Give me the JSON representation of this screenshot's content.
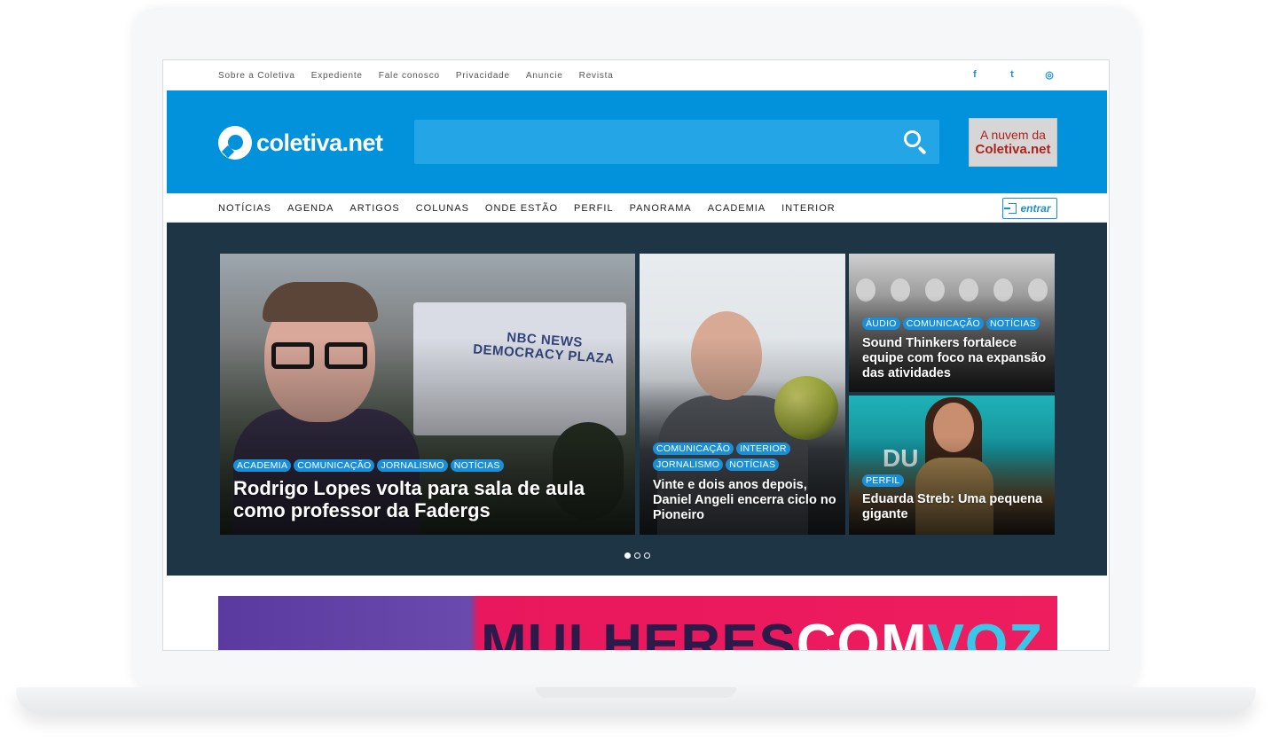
{
  "top_links": [
    "Sobre a Coletiva",
    "Expediente",
    "Fale conosco",
    "Privacidade",
    "Anuncie",
    "Revista"
  ],
  "social_icons": [
    "facebook-icon",
    "twitter-icon",
    "rss-icon"
  ],
  "social_glyphs": [
    "f",
    "t",
    "◎"
  ],
  "logo_text": "coletiva.net",
  "ad": {
    "line1": "A nuvem da",
    "line2": "Coletiva.net"
  },
  "nav_items": [
    "NOTÍCIAS",
    "AGENDA",
    "ARTIGOS",
    "COLUNAS",
    "ONDE ESTÃO",
    "PERFIL",
    "PANORAMA",
    "ACADEMIA",
    "INTERIOR"
  ],
  "login_label": "entrar",
  "hero": {
    "featured": {
      "tags": [
        "ACADEMIA",
        "COMUNICAÇÃO",
        "JORNALISMO",
        "NOTÍCIAS"
      ],
      "title": "Rodrigo Lopes volta para sala de aula como professor da Fadergs",
      "photo_text": "NBC NEWS DEMOCRACY PLAZA"
    },
    "middle": {
      "tags": [
        "COMUNICAÇÃO",
        "INTERIOR",
        "JORNALISMO",
        "NOTÍCIAS"
      ],
      "title": "Vinte e dois anos depois, Daniel Angeli encerra ciclo no Pioneiro"
    },
    "top_right": {
      "tags": [
        "ÁUDIO",
        "COMUNICAÇÃO",
        "NOTÍCIAS"
      ],
      "title": "Sound Thinkers fortalece equipe com foco na expansão das atividades"
    },
    "bottom_right": {
      "tags": [
        "PERFIL"
      ],
      "title": "Eduarda Streb: Uma pequena gigante",
      "photo_text": "DU"
    },
    "slides_total": 3,
    "slide_active": 1
  },
  "promo": {
    "part1": "MULHERES",
    "part2": "COM",
    "part3": "VOZ"
  },
  "colors": {
    "brand_blue": "#0192db",
    "hero_bg": "#1d3545",
    "tag_blue": "#1a8fd8",
    "promo_pink": "#ed1d5e"
  }
}
